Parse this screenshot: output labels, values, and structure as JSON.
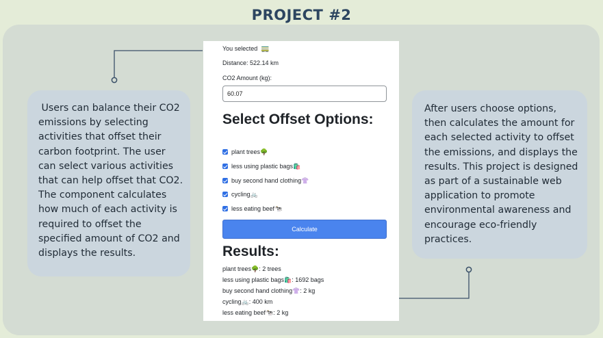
{
  "page": {
    "title": "PROJECT #2"
  },
  "left_note": {
    "text": " Users can balance their CO2 emissions by selecting activities that offset their carbon footprint. The user can select various activities that can help offset that CO2. The component calculates how much of each activity is required to offset the specified amount of CO2 and displays the results."
  },
  "right_note": {
    "text": "After users choose options, then calculates the amount  for each selected activity to offset the emissions, and displays the results. This project is designed as part of a sustainable web application to promote environmental awareness and encourage eco-friendly practices."
  },
  "app": {
    "selected_label": "You selected",
    "selected_emoji": "🚃",
    "distance": "Distance: 522.14 km",
    "co2_label": "CO2 Amount (kg):",
    "co2_value": "60.07",
    "offset_heading": "Select Offset Options:",
    "options": [
      {
        "label": "plant trees🌳",
        "checked": true
      },
      {
        "label": "less using plastic bags🛍️",
        "checked": true
      },
      {
        "label": "buy second hand clothing👚",
        "checked": true
      },
      {
        "label": "cycling🚲",
        "checked": true
      },
      {
        "label": "less eating beef🐄",
        "checked": true
      }
    ],
    "calculate_label": "Calculate",
    "results_heading": "Results:",
    "results": [
      "plant trees🌳: 2 trees",
      "less using plastic bags🛍️: 1692 bags",
      "buy second hand clothing👚: 2 kg",
      "cycling🚲: 400 km",
      "less eating beef🐄: 2 kg"
    ]
  },
  "colors": {
    "background": "#e4ecd8",
    "panel": "#d4dcd3",
    "note": "#cbd6de",
    "title": "#2c4560",
    "button": "#4a84ee",
    "checkbox": "#2f6fe4"
  }
}
